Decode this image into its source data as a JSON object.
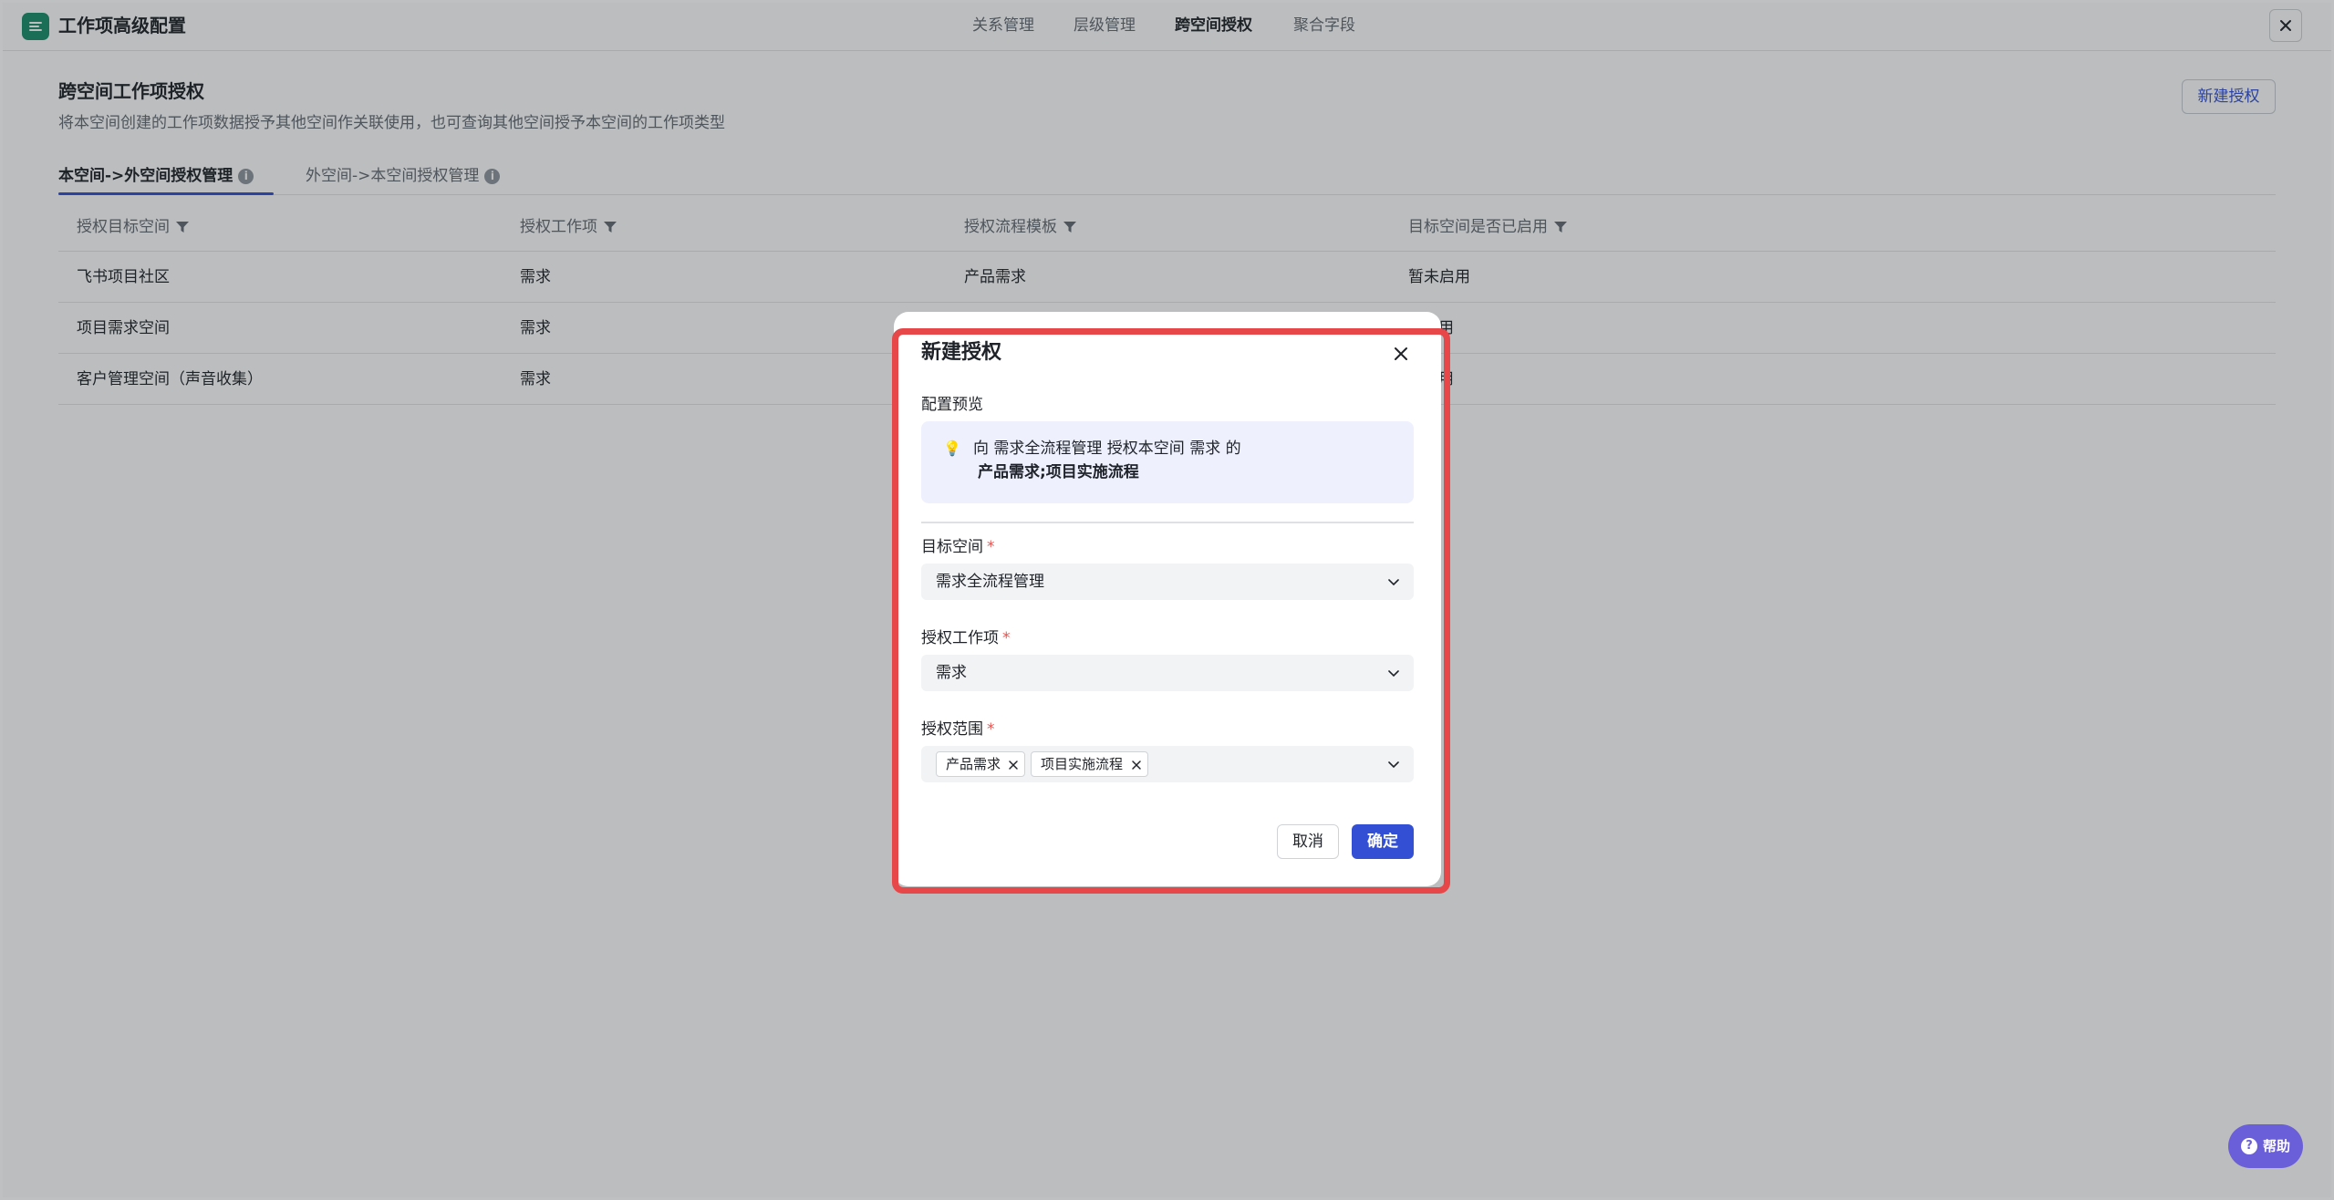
{
  "app": {
    "title": "工作项高级配置",
    "top_tabs": [
      "关系管理",
      "层级管理",
      "跨空间授权",
      "聚合字段"
    ],
    "active_top_tab": "跨空间授权"
  },
  "section": {
    "title": "跨空间工作项授权",
    "description": "将本空间创建的工作项数据授予其他空间作关联使用，也可查询其他空间授予本空间的工作项类型",
    "new_button": "新建授权"
  },
  "sub_tabs": [
    "本空间->外空间授权管理",
    "外空间->本空间授权管理"
  ],
  "table": {
    "headers": [
      "授权目标空间",
      "授权工作项",
      "授权流程模板",
      "目标空间是否已启用"
    ],
    "rows": [
      [
        "飞书项目社区",
        "需求",
        "产品需求",
        "暂未启用"
      ],
      [
        "项目需求空间",
        "需求",
        "",
        "用"
      ],
      [
        "客户管理空间（声音收集）",
        "需求",
        "",
        "用"
      ]
    ]
  },
  "modal": {
    "title": "新建授权",
    "preview_label": "配置预览",
    "preview_line1": "向 需求全流程管理 授权本空间 需求 的",
    "preview_line2": "产品需求;项目实施流程",
    "target_space_label": "目标空间",
    "target_space_value": "需求全流程管理",
    "work_item_label": "授权工作项",
    "work_item_value": "需求",
    "scope_label": "授权范围",
    "scope_tags": [
      "产品需求",
      "项目实施流程"
    ],
    "cancel": "取消",
    "confirm": "确定"
  },
  "help": {
    "label": "帮助"
  },
  "colors": {
    "primary": "#3350d4",
    "highlight": "#e8474a",
    "logo": "#1a8f6a",
    "help": "#6b5fd9"
  }
}
